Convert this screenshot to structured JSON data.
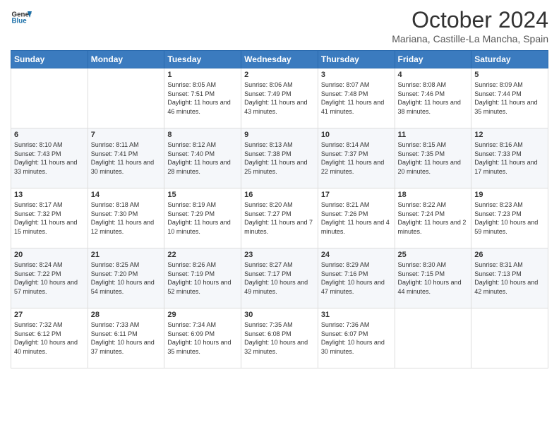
{
  "header": {
    "logo_line1": "General",
    "logo_line2": "Blue",
    "title": "October 2024",
    "subtitle": "Mariana, Castille-La Mancha, Spain"
  },
  "calendar": {
    "days_of_week": [
      "Sunday",
      "Monday",
      "Tuesday",
      "Wednesday",
      "Thursday",
      "Friday",
      "Saturday"
    ],
    "weeks": [
      [
        {
          "day": "",
          "info": ""
        },
        {
          "day": "",
          "info": ""
        },
        {
          "day": "1",
          "info": "Sunrise: 8:05 AM\nSunset: 7:51 PM\nDaylight: 11 hours and 46 minutes."
        },
        {
          "day": "2",
          "info": "Sunrise: 8:06 AM\nSunset: 7:49 PM\nDaylight: 11 hours and 43 minutes."
        },
        {
          "day": "3",
          "info": "Sunrise: 8:07 AM\nSunset: 7:48 PM\nDaylight: 11 hours and 41 minutes."
        },
        {
          "day": "4",
          "info": "Sunrise: 8:08 AM\nSunset: 7:46 PM\nDaylight: 11 hours and 38 minutes."
        },
        {
          "day": "5",
          "info": "Sunrise: 8:09 AM\nSunset: 7:44 PM\nDaylight: 11 hours and 35 minutes."
        }
      ],
      [
        {
          "day": "6",
          "info": "Sunrise: 8:10 AM\nSunset: 7:43 PM\nDaylight: 11 hours and 33 minutes."
        },
        {
          "day": "7",
          "info": "Sunrise: 8:11 AM\nSunset: 7:41 PM\nDaylight: 11 hours and 30 minutes."
        },
        {
          "day": "8",
          "info": "Sunrise: 8:12 AM\nSunset: 7:40 PM\nDaylight: 11 hours and 28 minutes."
        },
        {
          "day": "9",
          "info": "Sunrise: 8:13 AM\nSunset: 7:38 PM\nDaylight: 11 hours and 25 minutes."
        },
        {
          "day": "10",
          "info": "Sunrise: 8:14 AM\nSunset: 7:37 PM\nDaylight: 11 hours and 22 minutes."
        },
        {
          "day": "11",
          "info": "Sunrise: 8:15 AM\nSunset: 7:35 PM\nDaylight: 11 hours and 20 minutes."
        },
        {
          "day": "12",
          "info": "Sunrise: 8:16 AM\nSunset: 7:33 PM\nDaylight: 11 hours and 17 minutes."
        }
      ],
      [
        {
          "day": "13",
          "info": "Sunrise: 8:17 AM\nSunset: 7:32 PM\nDaylight: 11 hours and 15 minutes."
        },
        {
          "day": "14",
          "info": "Sunrise: 8:18 AM\nSunset: 7:30 PM\nDaylight: 11 hours and 12 minutes."
        },
        {
          "day": "15",
          "info": "Sunrise: 8:19 AM\nSunset: 7:29 PM\nDaylight: 11 hours and 10 minutes."
        },
        {
          "day": "16",
          "info": "Sunrise: 8:20 AM\nSunset: 7:27 PM\nDaylight: 11 hours and 7 minutes."
        },
        {
          "day": "17",
          "info": "Sunrise: 8:21 AM\nSunset: 7:26 PM\nDaylight: 11 hours and 4 minutes."
        },
        {
          "day": "18",
          "info": "Sunrise: 8:22 AM\nSunset: 7:24 PM\nDaylight: 11 hours and 2 minutes."
        },
        {
          "day": "19",
          "info": "Sunrise: 8:23 AM\nSunset: 7:23 PM\nDaylight: 10 hours and 59 minutes."
        }
      ],
      [
        {
          "day": "20",
          "info": "Sunrise: 8:24 AM\nSunset: 7:22 PM\nDaylight: 10 hours and 57 minutes."
        },
        {
          "day": "21",
          "info": "Sunrise: 8:25 AM\nSunset: 7:20 PM\nDaylight: 10 hours and 54 minutes."
        },
        {
          "day": "22",
          "info": "Sunrise: 8:26 AM\nSunset: 7:19 PM\nDaylight: 10 hours and 52 minutes."
        },
        {
          "day": "23",
          "info": "Sunrise: 8:27 AM\nSunset: 7:17 PM\nDaylight: 10 hours and 49 minutes."
        },
        {
          "day": "24",
          "info": "Sunrise: 8:29 AM\nSunset: 7:16 PM\nDaylight: 10 hours and 47 minutes."
        },
        {
          "day": "25",
          "info": "Sunrise: 8:30 AM\nSunset: 7:15 PM\nDaylight: 10 hours and 44 minutes."
        },
        {
          "day": "26",
          "info": "Sunrise: 8:31 AM\nSunset: 7:13 PM\nDaylight: 10 hours and 42 minutes."
        }
      ],
      [
        {
          "day": "27",
          "info": "Sunrise: 7:32 AM\nSunset: 6:12 PM\nDaylight: 10 hours and 40 minutes."
        },
        {
          "day": "28",
          "info": "Sunrise: 7:33 AM\nSunset: 6:11 PM\nDaylight: 10 hours and 37 minutes."
        },
        {
          "day": "29",
          "info": "Sunrise: 7:34 AM\nSunset: 6:09 PM\nDaylight: 10 hours and 35 minutes."
        },
        {
          "day": "30",
          "info": "Sunrise: 7:35 AM\nSunset: 6:08 PM\nDaylight: 10 hours and 32 minutes."
        },
        {
          "day": "31",
          "info": "Sunrise: 7:36 AM\nSunset: 6:07 PM\nDaylight: 10 hours and 30 minutes."
        },
        {
          "day": "",
          "info": ""
        },
        {
          "day": "",
          "info": ""
        }
      ]
    ]
  }
}
